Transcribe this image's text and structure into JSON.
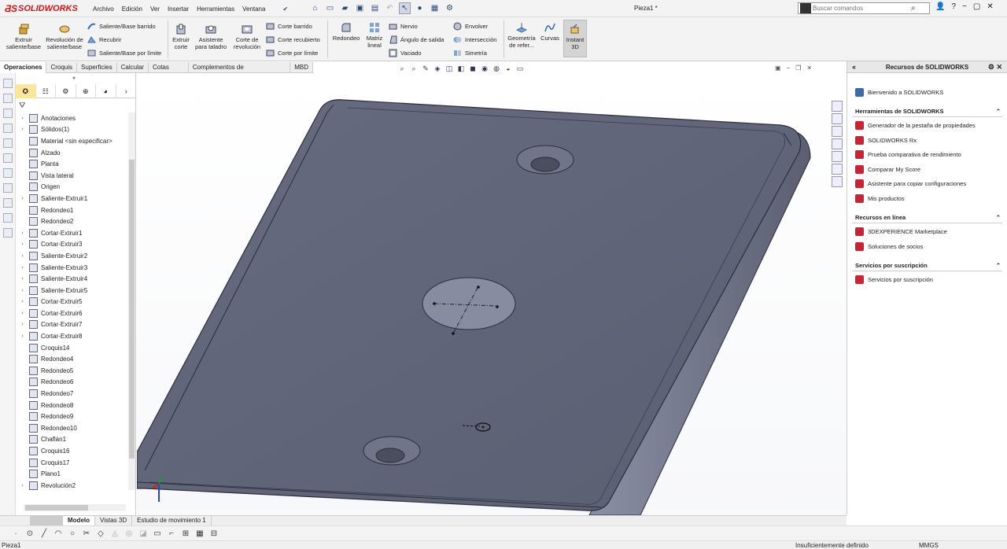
{
  "app": {
    "logo_text": "SOLIDWORKS",
    "doc_title": "Pieza1 *"
  },
  "menu": [
    "Archivo",
    "Edición",
    "Ver",
    "Insertar",
    "Herramientas",
    "Ventana"
  ],
  "search": {
    "placeholder": "Buscar comandos"
  },
  "ribbon": {
    "extruir_saliente": "Extruir saliente/base",
    "revolucion": "Revolución de saliente/base",
    "saliente_barrido": "Saliente/Base barrido",
    "recubrir": "Recubrir",
    "saliente_limite": "Saliente/Base por límite",
    "extruir_corte": "Extruir corte",
    "asistente_taladro": "Asistente para taladro",
    "corte_revolucion": "Corte de revolución",
    "corte_barrido": "Corte barrido",
    "corte_recubierto": "Corte recubierto",
    "corte_limite": "Corte por límite",
    "redondeo": "Redondeo",
    "matriz_lineal": "Matriz lineal",
    "nervio": "Nervio",
    "angulo_salida": "Ángulo de salida",
    "vaciado": "Vaciado",
    "envolver": "Envolver",
    "interseccion": "Intersección",
    "simetria": "Simetría",
    "geometria_ref": "Geometría de refer...",
    "curvas": "Curvas",
    "instant3d": "Instant 3D"
  },
  "tabs": [
    "Operaciones",
    "Croquis",
    "Superficies",
    "Calcular",
    "Cotas MBD",
    "Complementos de SOLIDWORKS",
    "MBD"
  ],
  "tree": [
    {
      "label": "Anotaciones",
      "exp": true
    },
    {
      "label": "Sólidos(1)",
      "exp": true
    },
    {
      "label": "Material <sin especificar>",
      "exp": false
    },
    {
      "label": "Alzado",
      "exp": false
    },
    {
      "label": "Planta",
      "exp": false
    },
    {
      "label": "Vista lateral",
      "exp": false
    },
    {
      "label": "Origen",
      "exp": false
    },
    {
      "label": "Saliente-Extruir1",
      "exp": true
    },
    {
      "label": "Redondeo1",
      "exp": false
    },
    {
      "label": "Redondeo2",
      "exp": false
    },
    {
      "label": "Cortar-Extruir1",
      "exp": true
    },
    {
      "label": "Cortar-Extruir3",
      "exp": true
    },
    {
      "label": "Saliente-Extruir2",
      "exp": true
    },
    {
      "label": "Saliente-Extruir3",
      "exp": true
    },
    {
      "label": "Saliente-Extruir4",
      "exp": true
    },
    {
      "label": "Saliente-Extruir5",
      "exp": true
    },
    {
      "label": "Cortar-Extruir5",
      "exp": true
    },
    {
      "label": "Cortar-Extruir6",
      "exp": true
    },
    {
      "label": "Cortar-Extruir7",
      "exp": true
    },
    {
      "label": "Cortar-Extruir8",
      "exp": true
    },
    {
      "label": "Croquis14",
      "exp": false
    },
    {
      "label": "Redondeo4",
      "exp": false
    },
    {
      "label": "Redondeo5",
      "exp": false
    },
    {
      "label": "Redondeo6",
      "exp": false
    },
    {
      "label": "Redondeo7",
      "exp": false
    },
    {
      "label": "Redondeo8",
      "exp": false
    },
    {
      "label": "Redondeo9",
      "exp": false
    },
    {
      "label": "Redondeo10",
      "exp": false
    },
    {
      "label": "Chaflán1",
      "exp": false
    },
    {
      "label": "Croquis16",
      "exp": false
    },
    {
      "label": "Croquis17",
      "exp": false
    },
    {
      "label": "Plano1",
      "exp": false
    },
    {
      "label": "Revolución2",
      "exp": true
    }
  ],
  "panel": {
    "title": "Recursos de SOLIDWORKS",
    "welcome": "Bienvenido a SOLIDWORKS",
    "sec_tools": "Herramientas de SOLIDWORKS",
    "tools": [
      "Generador de la pestaña de propiedades",
      "SOLIDWORKS Rx",
      "Prueba comparativa de rendimiento",
      "Comparar My Score",
      "Asistente para copiar configuraciones",
      "Mis productos"
    ],
    "sec_online": "Recursos en línea",
    "online": [
      "3DEXPERIENCE Marketplace",
      "Soluciones de socios"
    ],
    "sec_subs": "Servicios por suscripción",
    "subs": [
      "Servicios por suscripción"
    ]
  },
  "bottom_tabs": [
    "Modelo",
    "Vistas 3D",
    "Estudio de movimiento 1"
  ],
  "status": {
    "doc": "Pieza1",
    "state": "Insuficientemente definido",
    "units": "MMGS"
  },
  "colors": {
    "part": "#6b6f82",
    "edge": "#2b2d38",
    "accent": "#2a4a7a"
  }
}
